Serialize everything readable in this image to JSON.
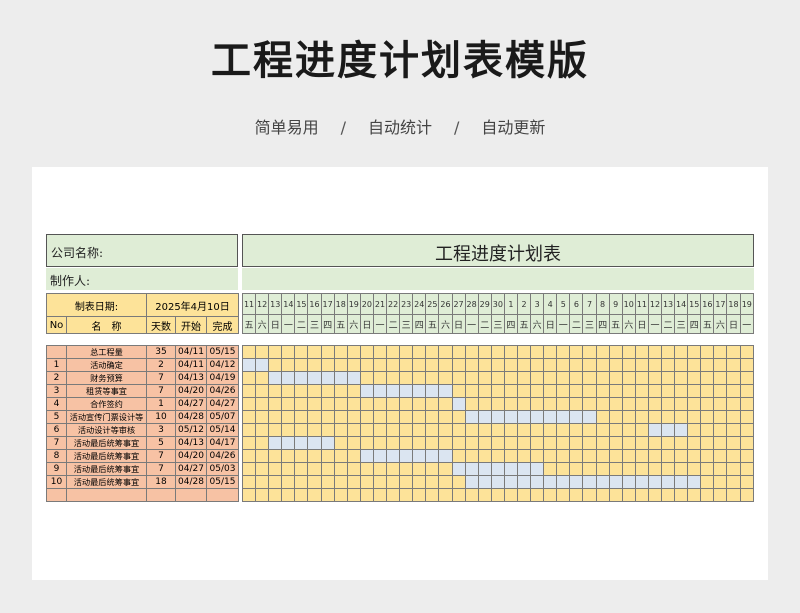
{
  "page_title": "工程进度计划表模版",
  "tagline": [
    "简单易用",
    "自动统计",
    "自动更新"
  ],
  "tagline_sep": "/",
  "sheet": {
    "company_label": "公司名称:",
    "maker_label": "制作人:",
    "chart_title": "工程进度计划表",
    "date_label": "制表日期:",
    "date_value": "2025年4月10日",
    "headers": {
      "no": "No",
      "name": "名　称",
      "days": "天数",
      "start": "开始",
      "end": "完成"
    },
    "day_numbers": [
      "11",
      "12",
      "13",
      "14",
      "15",
      "16",
      "17",
      "18",
      "19",
      "20",
      "21",
      "22",
      "23",
      "24",
      "25",
      "26",
      "27",
      "28",
      "29",
      "30",
      "1",
      "2",
      "3",
      "4",
      "5",
      "6",
      "7",
      "8",
      "9",
      "10",
      "11",
      "12",
      "13",
      "14",
      "15",
      "16",
      "17",
      "18",
      "19"
    ],
    "weekdays": [
      "五",
      "六",
      "日",
      "一",
      "二",
      "三",
      "四",
      "五",
      "六",
      "日",
      "一",
      "二",
      "三",
      "四",
      "五",
      "六",
      "日",
      "一",
      "二",
      "三",
      "四",
      "五",
      "六",
      "日",
      "一",
      "二",
      "三",
      "四",
      "五",
      "六",
      "日",
      "一",
      "二",
      "三",
      "四",
      "五",
      "六",
      "日",
      "一"
    ],
    "tasks": [
      {
        "no": "",
        "name": "总工程量",
        "days": "35",
        "start": "04/11",
        "end": "05/15",
        "bar_from": 0,
        "bar_to": 0
      },
      {
        "no": "1",
        "name": "活动确定",
        "days": "2",
        "start": "04/11",
        "end": "04/12",
        "bar_from": 0,
        "bar_to": 1
      },
      {
        "no": "2",
        "name": "财务预算",
        "days": "7",
        "start": "04/13",
        "end": "04/19",
        "bar_from": 2,
        "bar_to": 8
      },
      {
        "no": "3",
        "name": "租赁等事宜",
        "days": "7",
        "start": "04/20",
        "end": "04/26",
        "bar_from": 9,
        "bar_to": 15
      },
      {
        "no": "4",
        "name": "合作签约",
        "days": "1",
        "start": "04/27",
        "end": "04/27",
        "bar_from": 16,
        "bar_to": 16
      },
      {
        "no": "5",
        "name": "活动宣传门票设计等",
        "days": "10",
        "start": "04/28",
        "end": "05/07",
        "bar_from": 17,
        "bar_to": 26
      },
      {
        "no": "6",
        "name": "活动设计等审核",
        "days": "3",
        "start": "05/12",
        "end": "05/14",
        "bar_from": 31,
        "bar_to": 33
      },
      {
        "no": "7",
        "name": "活动最后统筹事宜",
        "days": "5",
        "start": "04/13",
        "end": "04/17",
        "bar_from": 2,
        "bar_to": 6
      },
      {
        "no": "8",
        "name": "活动最后统筹事宜",
        "days": "7",
        "start": "04/20",
        "end": "04/26",
        "bar_from": 9,
        "bar_to": 15
      },
      {
        "no": "9",
        "name": "活动最后统筹事宜",
        "days": "7",
        "start": "04/27",
        "end": "05/03",
        "bar_from": 16,
        "bar_to": 22
      },
      {
        "no": "10",
        "name": "活动最后统筹事宜",
        "days": "18",
        "start": "04/28",
        "end": "05/15",
        "bar_from": 17,
        "bar_to": 34
      }
    ]
  },
  "colors": {
    "header_green": "#dfedd6",
    "info_yellow": "#fde399",
    "task_salmon": "#f7c2a4",
    "bar_blue": "#dbe5f1"
  }
}
